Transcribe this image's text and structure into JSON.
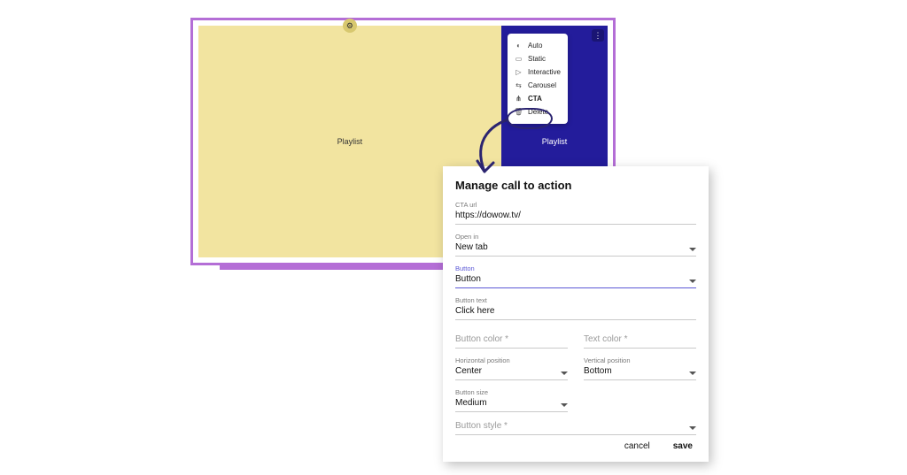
{
  "editor": {
    "left_tile_label": "Playlist",
    "right_tile_label": "Playlist"
  },
  "context_menu": {
    "items": [
      {
        "icon": "auto-icon",
        "glyph": "◐",
        "label": "Auto"
      },
      {
        "icon": "static-icon",
        "glyph": "▭",
        "label": "Static"
      },
      {
        "icon": "interactive-icon",
        "glyph": "▷",
        "label": "Interactive"
      },
      {
        "icon": "carousel-icon",
        "glyph": "⇆",
        "label": "Carousel"
      },
      {
        "icon": "cta-icon",
        "glyph": "⋔",
        "label": "CTA",
        "highlight": true
      },
      {
        "icon": "delete-icon",
        "glyph": "🗑",
        "label": "Delete"
      }
    ]
  },
  "dialog": {
    "title": "Manage call to action",
    "fields": {
      "cta_url": {
        "label": "CTA url",
        "value": "https://dowow.tv/"
      },
      "open_in": {
        "label": "Open in",
        "value": "New tab"
      },
      "button": {
        "label": "Button",
        "value": "Button"
      },
      "button_text": {
        "label": "Button text",
        "value": "Click here"
      },
      "button_color": {
        "label": "Button color *",
        "value": ""
      },
      "text_color": {
        "label": "Text color *",
        "value": ""
      },
      "h_pos": {
        "label": "Horizontal position",
        "value": "Center"
      },
      "v_pos": {
        "label": "Vertical position",
        "value": "Bottom"
      },
      "size": {
        "label": "Button size",
        "value": "Medium"
      },
      "style": {
        "label": "Button style *",
        "value": ""
      }
    },
    "actions": {
      "cancel": "cancel",
      "save": "save"
    }
  }
}
